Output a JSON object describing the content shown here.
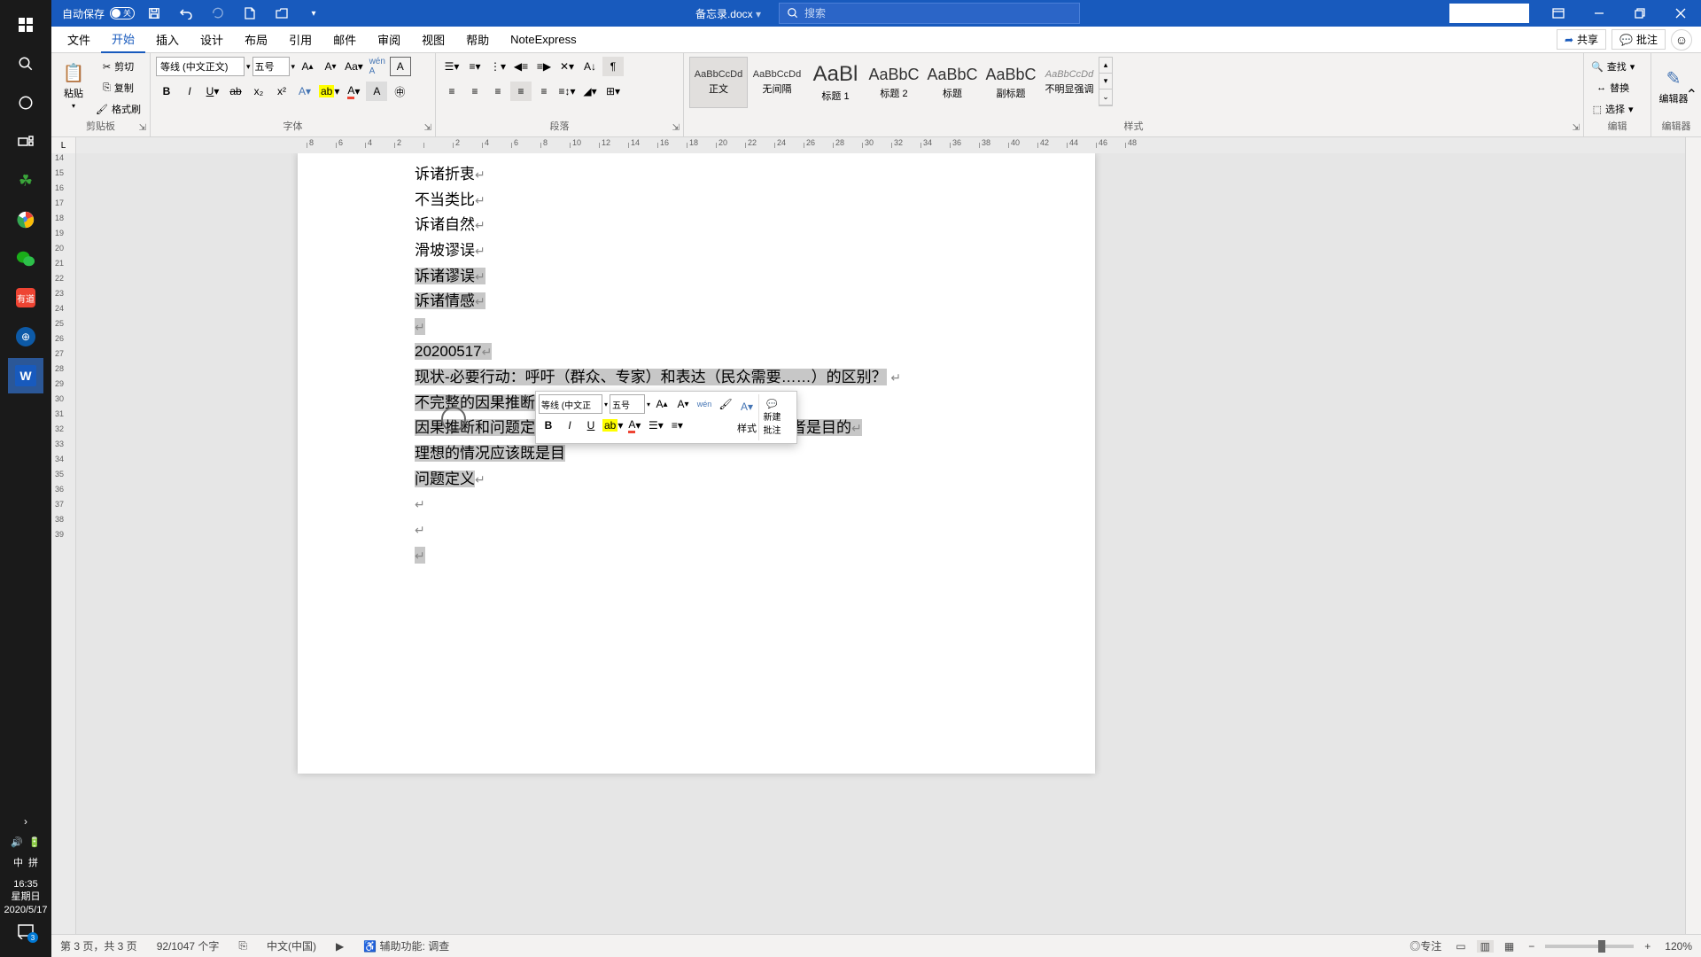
{
  "titlebar": {
    "autosave_label": "自动保存",
    "autosave_state": "关",
    "doc_title": "备忘录.docx",
    "search_placeholder": "搜索"
  },
  "tabs": {
    "items": [
      "文件",
      "开始",
      "插入",
      "设计",
      "布局",
      "引用",
      "邮件",
      "审阅",
      "视图",
      "帮助",
      "NoteExpress"
    ],
    "active_index": 1,
    "share": "共享",
    "comments": "批注"
  },
  "ribbon": {
    "clipboard": {
      "label": "剪贴板",
      "paste": "粘贴",
      "cut": "剪切",
      "copy": "复制",
      "format_painter": "格式刷"
    },
    "font": {
      "label": "字体",
      "name_value": "等线 (中文正文)",
      "size_value": "五号"
    },
    "paragraph": {
      "label": "段落"
    },
    "styles": {
      "label": "样式",
      "items": [
        {
          "preview": "AaBbCcDd",
          "name": "正文",
          "size": "s"
        },
        {
          "preview": "AaBbCcDd",
          "name": "无间隔",
          "size": "s"
        },
        {
          "preview": "AaBl",
          "name": "标题 1",
          "size": "big"
        },
        {
          "preview": "AaBbC",
          "name": "标题 2",
          "size": "m"
        },
        {
          "preview": "AaBbC",
          "name": "标题",
          "size": "m"
        },
        {
          "preview": "AaBbC",
          "name": "副标题",
          "size": "m"
        },
        {
          "preview": "AaBbCcDd",
          "name": "不明显强调",
          "size": "s"
        }
      ]
    },
    "editing": {
      "label": "编辑",
      "find": "查找",
      "replace": "替换",
      "select": "选择"
    },
    "editor": {
      "label": "编辑器",
      "button": "编辑器"
    }
  },
  "ruler_h": [
    "8",
    "6",
    "4",
    "2",
    "",
    "2",
    "4",
    "6",
    "8",
    "10",
    "12",
    "14",
    "16",
    "18",
    "20",
    "22",
    "24",
    "26",
    "28",
    "30",
    "32",
    "34",
    "36",
    "38",
    "40",
    "42",
    "44",
    "46",
    "48"
  ],
  "ruler_v": [
    "14",
    "15",
    "16",
    "17",
    "18",
    "19",
    "20",
    "21",
    "22",
    "23",
    "24",
    "25",
    "26",
    "27",
    "28",
    "29",
    "30",
    "31",
    "32",
    "33",
    "34",
    "35",
    "36",
    "37",
    "38",
    "39"
  ],
  "document": {
    "lines": [
      "诉诸折衷",
      "不当类比",
      "诉诸自然",
      "滑坡谬误",
      "诉诸谬误",
      "诉诸情感",
      "",
      "20200517",
      "现状-必要行动：呼吁（群众、专家）和表达（民众需要……）的区别？",
      "不完整的因果推断逻辑？",
      "因果推断和问题定义不在一个层次上……前者是方式，后者是目的",
      "理想的情况应该既是目",
      "问题定义",
      "",
      "",
      ""
    ]
  },
  "mini_toolbar": {
    "font": "等线 (中文正",
    "size": "五号",
    "style": "样式",
    "new_comment_l1": "新建",
    "new_comment_l2": "批注"
  },
  "statusbar": {
    "page": "第 3 页，共 3 页",
    "words": "92/1047 个字",
    "lang": "中文(中国)",
    "accessibility": "辅助功能: 调查",
    "focus": "专注",
    "zoom": "120%"
  },
  "taskbar": {
    "time": "16:35",
    "day": "星期日",
    "date": "2020/5/17",
    "ime1": "中",
    "ime2": "拼"
  }
}
